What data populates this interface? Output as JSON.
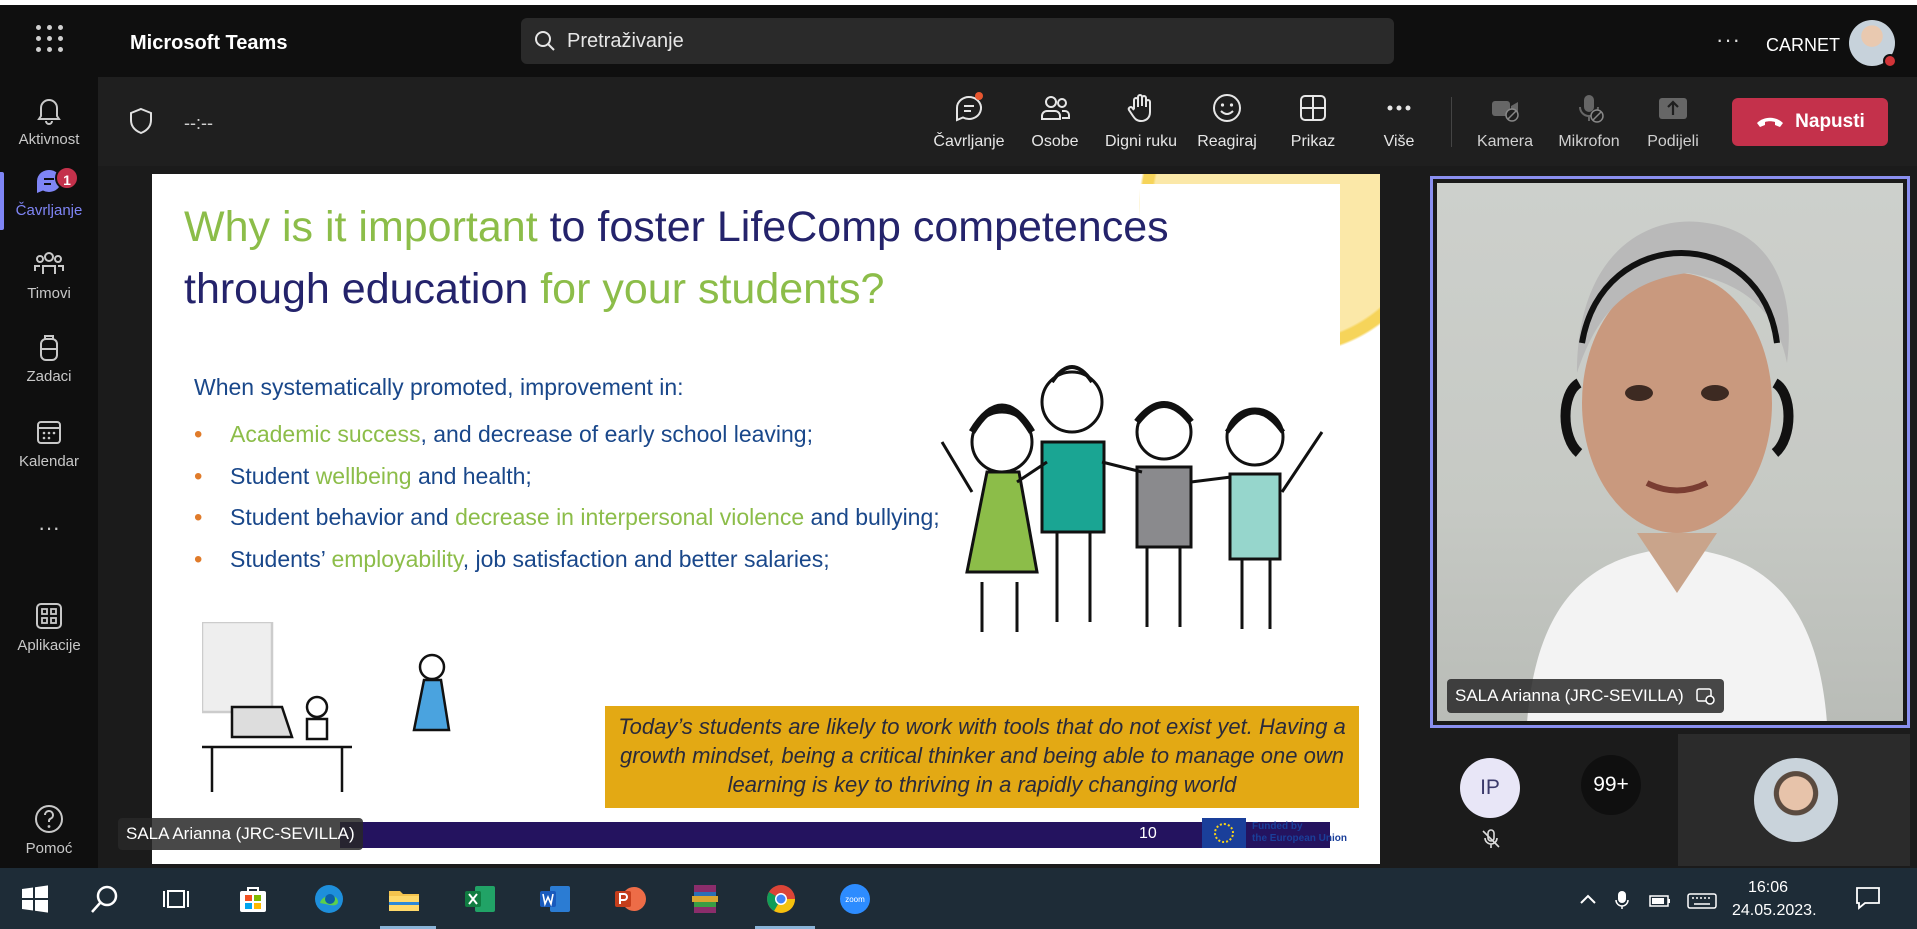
{
  "app": {
    "title": "Microsoft Teams",
    "search_placeholder": "Pretraživanje",
    "more": "···",
    "org_name": "CARNET"
  },
  "rail": {
    "items": [
      {
        "label": "Aktivnost",
        "icon": "bell-icon"
      },
      {
        "label": "Čavrljanje",
        "icon": "chat-icon",
        "badge": "1",
        "active": true
      },
      {
        "label": "Timovi",
        "icon": "teams-icon"
      },
      {
        "label": "Zadaci",
        "icon": "backpack-icon"
      },
      {
        "label": "Kalendar",
        "icon": "calendar-icon"
      },
      {
        "label": "···",
        "icon": "more-icon"
      },
      {
        "label": "Aplikacije",
        "icon": "apps-icon"
      },
      {
        "label": "Pomoć",
        "icon": "help-icon"
      }
    ]
  },
  "meeting": {
    "timer": "--:--",
    "tools": [
      {
        "label": "Čavrljanje",
        "icon": "chat-icon"
      },
      {
        "label": "Osobe",
        "icon": "people-icon"
      },
      {
        "label": "Digni ruku",
        "icon": "hand-icon"
      },
      {
        "label": "Reagiraj",
        "icon": "smiley-icon"
      },
      {
        "label": "Prikaz",
        "icon": "grid-icon"
      },
      {
        "label": "Više",
        "icon": "ellipsis-icon"
      },
      {
        "label": "Kamera",
        "icon": "camera-off-icon"
      },
      {
        "label": "Mikrofon",
        "icon": "mic-off-icon"
      },
      {
        "label": "Podijeli",
        "icon": "share-icon"
      }
    ],
    "leave_label": "Napusti",
    "leave_color": "#c4314b"
  },
  "slide": {
    "title_parts": [
      {
        "text": "Why is it important ",
        "color": "green"
      },
      {
        "text": "to foster LifeComp competences through education ",
        "color": "navy"
      },
      {
        "text": "for your students?",
        "color": "green"
      }
    ],
    "lead": "When systematically promoted, improvement in:",
    "bullets": [
      [
        {
          "t": "Academic success",
          "c": "green"
        },
        {
          "t": ", and decrease of early school leaving;",
          "c": "blue"
        }
      ],
      [
        {
          "t": "Student ",
          "c": "blue"
        },
        {
          "t": "wellbeing",
          "c": "green"
        },
        {
          "t": " and health;",
          "c": "blue"
        }
      ],
      [
        {
          "t": "Student behavior and ",
          "c": "blue"
        },
        {
          "t": "decrease in interpersonal violence",
          "c": "green"
        },
        {
          "t": " and bullying;",
          "c": "blue"
        }
      ],
      [
        {
          "t": "Students’ ",
          "c": "blue"
        },
        {
          "t": "employability",
          "c": "green"
        },
        {
          "t": ", job satisfaction and better salaries;",
          "c": "blue"
        }
      ]
    ],
    "quote": "Today’s students are likely to work with tools that do not exist yet. Having a growth mindset, being a critical thinker and being able to manage one own learning is key to thriving in a rapidly changing world",
    "page_number": "10",
    "eu_text_1": "Funded by",
    "eu_text_2": "the European Union"
  },
  "presenter": {
    "caption_left": "SALA Arianna (JRC-SEVILLA)",
    "caption_right": "SALA Arianna (JRC-SEVILLA)"
  },
  "participants": {
    "ip_initials": "IP",
    "overflow_count": "99+"
  },
  "taskbar": {
    "time": "16:06",
    "date": "24.05.2023."
  }
}
